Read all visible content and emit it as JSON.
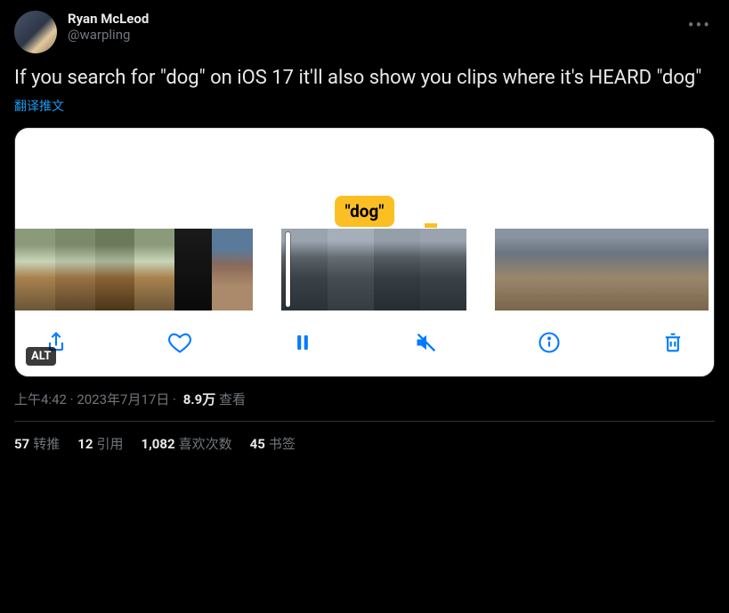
{
  "user": {
    "display_name": "Ryan McLeod",
    "handle": "@warpling"
  },
  "tweet_text": "If you search for \"dog\" on iOS 17 it'll also show you clips where it's HEARD \"dog\"",
  "translate_label": "翻译推文",
  "media": {
    "dog_label": "\"dog\"",
    "alt_badge": "ALT"
  },
  "meta": {
    "time": "上午4:42",
    "dot1": " · ",
    "date": "2023年7月17日",
    "dot2": " · ",
    "views_number": "8.9万",
    "views_label": " 查看"
  },
  "stats": {
    "retweets_num": "57",
    "retweets_label": "转推",
    "quotes_num": "12",
    "quotes_label": "引用",
    "likes_num": "1,082",
    "likes_label": "喜欢次数",
    "bookmarks_num": "45",
    "bookmarks_label": "书签"
  }
}
